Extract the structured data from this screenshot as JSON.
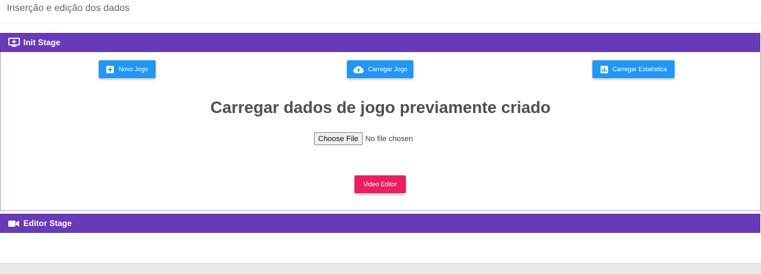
{
  "header": {
    "title": "Inserção e edição dos dados"
  },
  "init_stage": {
    "title": "Init Stage",
    "icon": "monitor-add-icon",
    "buttons": {
      "novo_jogo": "Novo Jogo",
      "carregar_jogo": "Carregar Jogo",
      "carregar_estatistica": "Carregar Estatística"
    },
    "heading": "Carregar dados de jogo previamente criado",
    "file_input": {
      "button_label": "Choose File",
      "status": "No file chosen"
    },
    "video_editor_label": "Video Editor"
  },
  "editor_stage": {
    "title": "Editor Stage",
    "icon": "videocam-icon"
  },
  "colors": {
    "stage_bar": "#673ab7",
    "primary_button": "#2196f3",
    "accent_button": "#e91e63",
    "heading_text": "#4f4f4f"
  }
}
